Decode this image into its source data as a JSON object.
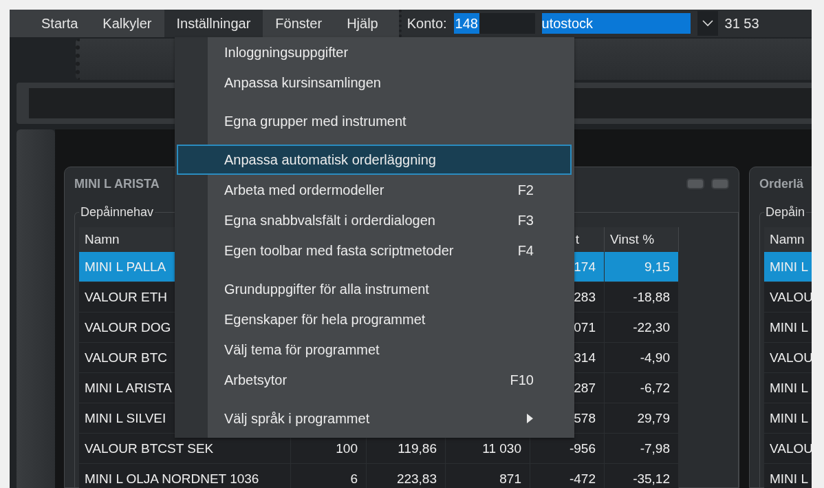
{
  "menubar": {
    "items": [
      {
        "label": "Starta",
        "selected": false
      },
      {
        "label": "Kalkyler",
        "selected": false
      },
      {
        "label": "Inställningar",
        "selected": true
      },
      {
        "label": "Fönster",
        "selected": false
      },
      {
        "label": "Hjälp",
        "selected": false
      }
    ]
  },
  "account": {
    "label": "Konto:",
    "number": "148",
    "name": "utostock",
    "balance": "31 53"
  },
  "menu": {
    "groups": [
      [
        {
          "label": "Inloggningsuppgifter",
          "submenu": false,
          "selected": false
        },
        {
          "label": "Anpassa kursinsamlingen",
          "submenu": false,
          "selected": false
        }
      ],
      [
        {
          "label": "Egna grupper med instrument",
          "submenu": false,
          "selected": false
        }
      ],
      [
        {
          "label": "Anpassa automatisk orderläggning",
          "submenu": false,
          "selected": true
        },
        {
          "label": "Arbeta med ordermodeller",
          "shortcut": "F2",
          "submenu": false,
          "selected": false
        },
        {
          "label": "Egna snabbvalsfält i orderdialogen",
          "shortcut": "F3",
          "submenu": false,
          "selected": false
        },
        {
          "label": "Egen toolbar med fasta scriptmetoder",
          "shortcut": "F4",
          "submenu": false,
          "selected": false
        }
      ],
      [
        {
          "label": "Grunduppgifter för alla instrument",
          "submenu": false,
          "selected": false
        },
        {
          "label": "Egenskaper för hela programmet",
          "submenu": false,
          "selected": false
        },
        {
          "label": "Välj tema för programmet",
          "submenu": false,
          "selected": false
        },
        {
          "label": "Arbetsytor",
          "shortcut": "F10",
          "submenu": false,
          "selected": false
        }
      ],
      [
        {
          "label": "Välj språk i programmet",
          "submenu": true,
          "selected": false
        }
      ]
    ]
  },
  "holdings_window": {
    "title": "MINI L ARISTA",
    "group": "Depåinnehav",
    "columns": [
      {
        "label": "Namn"
      },
      {},
      {},
      {},
      {
        "label": "t"
      },
      {
        "label": "Vinst %"
      }
    ],
    "rows": [
      {
        "selected": true,
        "cells": [
          "MINI L PALLA",
          null,
          null,
          null,
          "174",
          "9,15"
        ]
      },
      {
        "selected": false,
        "cells": [
          "VALOUR ETH",
          null,
          null,
          null,
          "283",
          "-18,88"
        ]
      },
      {
        "selected": false,
        "cells": [
          "VALOUR DOG",
          null,
          null,
          null,
          "071",
          "-22,30"
        ]
      },
      {
        "selected": false,
        "cells": [
          "VALOUR BTC",
          null,
          null,
          null,
          "314",
          "-4,90"
        ]
      },
      {
        "selected": false,
        "cells": [
          "MINI L ARISTA",
          null,
          null,
          null,
          "287",
          "-6,72"
        ]
      },
      {
        "selected": false,
        "cells": [
          "MINI L SILVEI",
          null,
          null,
          null,
          "578",
          "29,79"
        ]
      },
      {
        "selected": false,
        "cells": [
          "VALOUR BTCST SEK",
          "100",
          "119,86",
          "11 030",
          "-956",
          "-7,98"
        ]
      },
      {
        "selected": false,
        "cells": [
          "MINI L OLJA NORDNET 1036",
          "6",
          "223,83",
          "871",
          "-472",
          "-35,12"
        ]
      }
    ]
  },
  "order_window": {
    "title": "Orderlä",
    "group": "Depåin",
    "column": "Namn",
    "rows": [
      {
        "name": "MINI L",
        "selected": true
      },
      {
        "name": "VALOU",
        "selected": false
      },
      {
        "name": "MINI L",
        "selected": false
      },
      {
        "name": "VALOU",
        "selected": false
      },
      {
        "name": "MINI L",
        "selected": false
      },
      {
        "name": "MINI L",
        "selected": false
      },
      {
        "name": "VALOU",
        "selected": false
      },
      {
        "name": "MINI L",
        "selected": false
      }
    ]
  }
}
